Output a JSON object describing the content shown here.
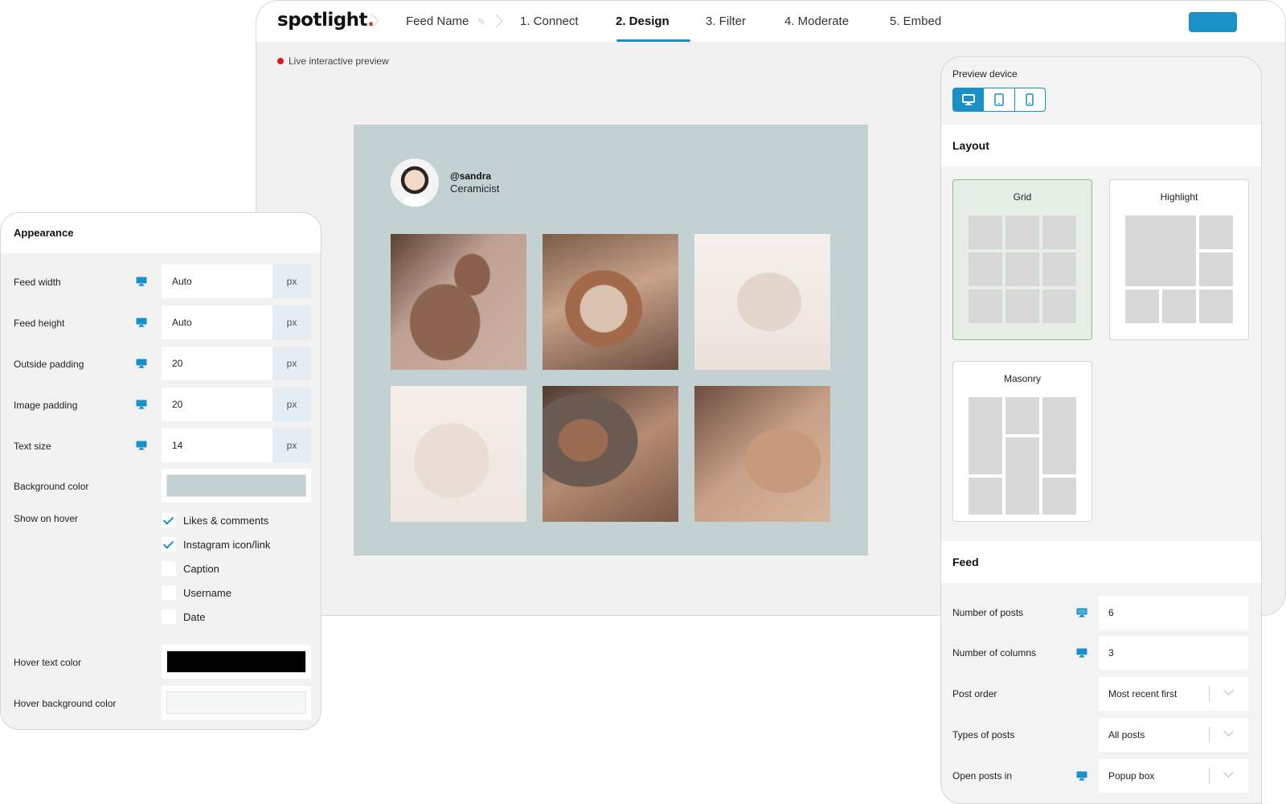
{
  "header": {
    "logo_text": "spotlight",
    "logo_dot": ".",
    "feed_name": "Feed Name",
    "steps": [
      {
        "label": "1. Connect",
        "active": false
      },
      {
        "label": "2. Design",
        "active": true
      },
      {
        "label": "3. Filter",
        "active": false
      },
      {
        "label": "4. Moderate",
        "active": false
      },
      {
        "label": "5. Embed",
        "active": false
      }
    ],
    "accent_color": "#1890c8"
  },
  "preview": {
    "live_label": "Live interactive preview",
    "live_dot_color": "#e2161a",
    "background_color": "#c3d1d2",
    "profile": {
      "username": "@sandra",
      "bio": "Ceramicist"
    },
    "posts": [
      {
        "subject": "clay vases"
      },
      {
        "subject": "pottery wheel"
      },
      {
        "subject": "stacked cups"
      },
      {
        "subject": "scattered cups"
      },
      {
        "subject": "coffee mug"
      },
      {
        "subject": "shaping clay"
      }
    ]
  },
  "appearance": {
    "title": "Appearance",
    "fields": [
      {
        "label": "Feed width",
        "value": "Auto",
        "unit": "px"
      },
      {
        "label": "Feed height",
        "value": "Auto",
        "unit": "px"
      },
      {
        "label": "Outside padding",
        "value": "20",
        "unit": "px"
      },
      {
        "label": "Image padding",
        "value": "20",
        "unit": "px"
      },
      {
        "label": "Text size",
        "value": "14",
        "unit": "px"
      }
    ],
    "background_color": {
      "label": "Background color",
      "value": "#c3d1d2"
    },
    "show_on_hover": {
      "label": "Show on hover",
      "options": [
        {
          "label": "Likes & comments",
          "checked": true
        },
        {
          "label": "Instagram icon/link",
          "checked": true
        },
        {
          "label": "Caption",
          "checked": false
        },
        {
          "label": "Username",
          "checked": false
        },
        {
          "label": "Date",
          "checked": false
        }
      ]
    },
    "hover_text_color": {
      "label": "Hover text color",
      "value": "#000000"
    },
    "hover_background_color": {
      "label": "Hover background color",
      "value": "#f6f7f7"
    }
  },
  "settings": {
    "preview_device": {
      "label": "Preview device",
      "options": [
        "desktop",
        "tablet",
        "phone"
      ],
      "selected": "desktop"
    },
    "layout": {
      "title": "Layout",
      "options": [
        {
          "label": "Grid",
          "selected": true
        },
        {
          "label": "Highlight",
          "selected": false
        },
        {
          "label": "Masonry",
          "selected": false
        }
      ]
    },
    "feed": {
      "title": "Feed",
      "number_of_posts": {
        "label": "Number of posts",
        "value": "6"
      },
      "number_of_columns": {
        "label": "Number of columns",
        "value": "3"
      },
      "post_order": {
        "label": "Post order",
        "value": "Most recent first"
      },
      "types_of_posts": {
        "label": "Types of posts",
        "value": "All posts"
      },
      "open_posts_in": {
        "label": "Open posts in",
        "value": "Popup box"
      }
    }
  }
}
